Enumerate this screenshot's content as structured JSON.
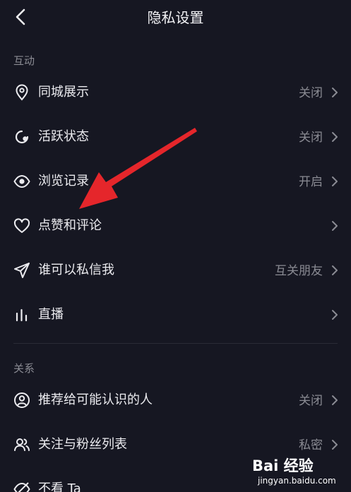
{
  "header": {
    "title": "隐私设置"
  },
  "sections": [
    {
      "label": "互动"
    },
    {
      "label": "关系"
    }
  ],
  "interaction_rows": [
    {
      "label": "同城展示",
      "value": "关闭",
      "icon": "location-pin-icon"
    },
    {
      "label": "活跃状态",
      "value": "关闭",
      "icon": "activity-status-icon"
    },
    {
      "label": "浏览记录",
      "value": "开启",
      "icon": "eye-icon"
    },
    {
      "label": "点赞和评论",
      "value": "",
      "icon": "heart-icon"
    },
    {
      "label": "谁可以私信我",
      "value": "互关朋友",
      "icon": "send-message-icon"
    },
    {
      "label": "直播",
      "value": "",
      "icon": "live-bars-icon"
    }
  ],
  "relation_rows": [
    {
      "label": "推荐给可能认识的人",
      "value": "关闭",
      "icon": "user-circle-icon"
    },
    {
      "label": "关注与粉丝列表",
      "value": "私密",
      "icon": "users-icon"
    },
    {
      "label": "不看 Ta",
      "value": "",
      "icon": "eye-off-icon"
    }
  ],
  "watermark": {
    "top": "Bai 经验",
    "bottom": "jingyan.baidu.com"
  },
  "colors": {
    "background": "#161722",
    "text": "#ebebef",
    "secondary": "#8a8b93",
    "arrow": "#e5262b"
  }
}
